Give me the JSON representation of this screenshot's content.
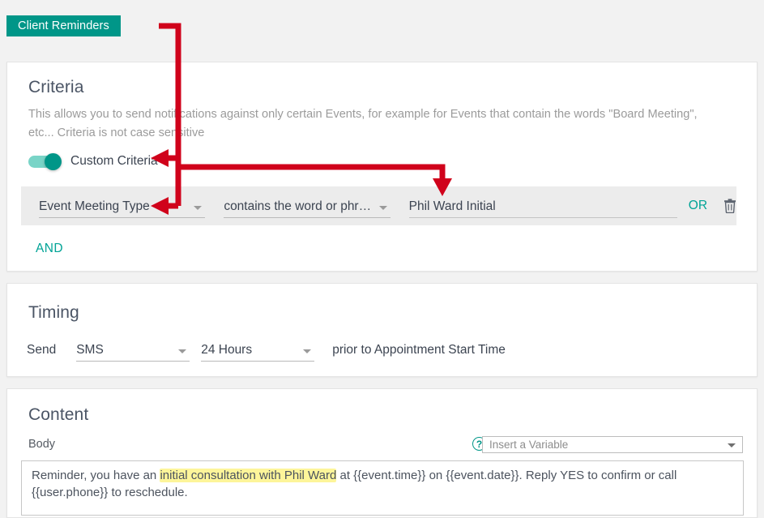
{
  "tabs": {
    "active_label": "Client Reminders",
    "active_color": "#009688"
  },
  "criteria": {
    "title": "Criteria",
    "description": "This allows you to send notifications against only certain Events, for example for Events that contain the words \"Board Meeting\", etc... Criteria is not case sensitive",
    "toggle_label": "Custom Criteria",
    "toggle_on": "true",
    "row": {
      "field": "Event Meeting Type",
      "operator": "contains the word or phr…",
      "value": "Phil Ward Initial",
      "or_label": "OR",
      "delete_icon": "trash-icon"
    },
    "and_label": "AND"
  },
  "timing": {
    "title": "Timing",
    "send_label": "Send",
    "channel": "SMS",
    "lead_time": "24 Hours",
    "suffix": "prior to Appointment Start Time"
  },
  "content": {
    "title": "Content",
    "body_label": "Body",
    "help_icon": "question-mark-icon",
    "variable_placeholder": "Insert a Variable",
    "body": {
      "before": "Reminder, you have an ",
      "highlight": "initial consultation with Phil Ward",
      "after": " at {{event.time}} on {{event.date}}.  Reply YES to confirm or call {{user.phone}} to reschedule."
    }
  },
  "annotations": {
    "color": "#d0021b",
    "description": "Red arrows drawn from the Client Reminders tab to Custom Criteria, Event Meeting Type, and the criteria value field"
  }
}
